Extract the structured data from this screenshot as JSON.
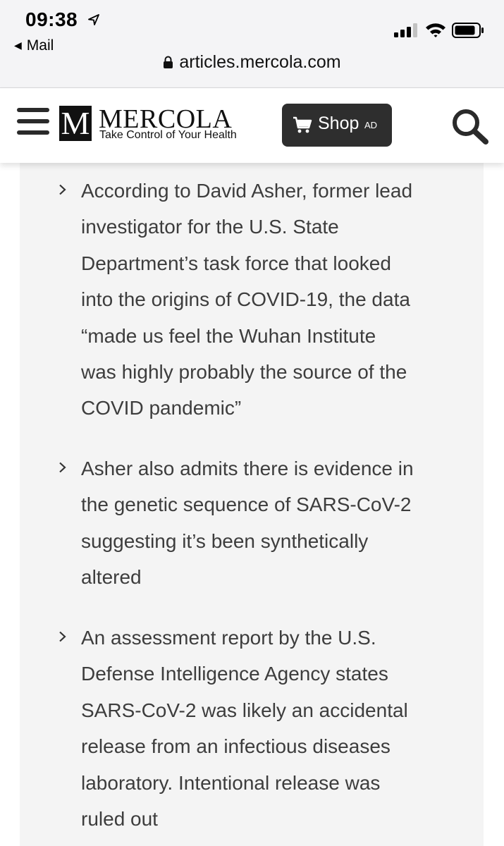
{
  "status_bar": {
    "time": "09:38",
    "back_app": "Mail",
    "icons": [
      "location-arrow-icon",
      "cellular-signal-icon",
      "wifi-icon",
      "battery-icon"
    ]
  },
  "browser": {
    "url": "articles.mercola.com",
    "icons": [
      "lock-icon"
    ]
  },
  "site_header": {
    "logo_letter": "M",
    "logo_text": "MERCOLA",
    "tagline": "Take Control of Your Health",
    "shop_label": "Shop",
    "shop_ad": "AD",
    "icons": [
      "hamburger-menu-icon",
      "shopping-cart-icon",
      "search-icon"
    ]
  },
  "content": {
    "bullets": [
      {
        "lines": [
          "According to David Asher, former lead",
          "investigator for the U.S. State",
          "Department’s task force that looked",
          "into the origins of COVID-19, the data",
          "“made us feel the Wuhan Institute",
          "was highly probably the source of the",
          "COVID pandemic”"
        ]
      },
      {
        "lines": [
          "Asher also admits there is evidence in",
          "the genetic sequence of SARS-CoV-2",
          "suggesting it’s been synthetically",
          "altered"
        ]
      },
      {
        "lines": [
          "An assessment report by the U.S.",
          "Defense Intelligence Agency states",
          "SARS-CoV-2 was likely an accidental",
          "release from an infectious diseases",
          "laboratory. Intentional release was",
          "ruled out"
        ]
      }
    ],
    "icons": [
      "chevron-right-icon"
    ]
  },
  "colors": {
    "status_bg": "#f4f4f6",
    "content_bg": "#f4f4f4",
    "text": "#3d3d3d",
    "shop_button": "#2e2e2e"
  }
}
